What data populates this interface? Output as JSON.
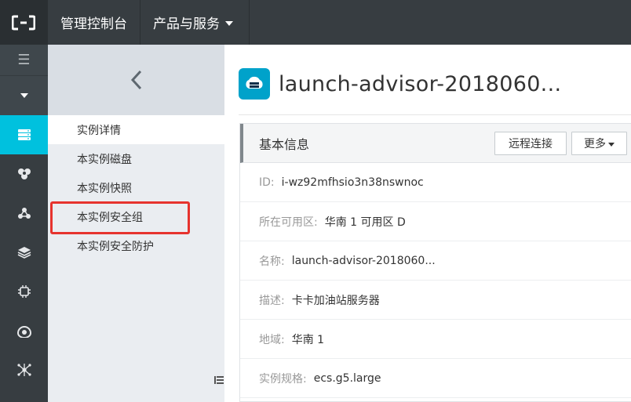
{
  "topbar": {
    "logo_icon": "aliyun-logo-icon",
    "console_label": "管理控制台",
    "products_label": "产品与服务"
  },
  "iconbar": {
    "accent_color": "#00c1de",
    "menu_glyph": "☰",
    "items": [
      "ecs-server-icon",
      "cluster-icon",
      "network-icon",
      "layers-icon",
      "chip-icon",
      "eye-icon",
      "molecule-icon"
    ]
  },
  "subside": {
    "back_icon": "chevron-left-icon",
    "items": [
      {
        "label": "实例详情",
        "active": true
      },
      {
        "label": "本实例磁盘"
      },
      {
        "label": "本实例快照"
      },
      {
        "label": "本实例安全组",
        "highlighted": true
      },
      {
        "label": "本实例安全防护"
      }
    ]
  },
  "main": {
    "title": "launch-advisor-2018060...",
    "panel": {
      "title": "基本信息",
      "remote_label": "远程连接",
      "more_label": "更多",
      "rows": [
        {
          "label": "ID:",
          "value": "i-wz92mfhsio3n38nswnoc"
        },
        {
          "label": "所在可用区:",
          "value": "华南 1 可用区 D"
        },
        {
          "label": "名称:",
          "value": "launch-advisor-2018060..."
        },
        {
          "label": "描述:",
          "value": "卡卡加油站服务器"
        },
        {
          "label": "地域:",
          "value": "华南 1"
        },
        {
          "label": "实例规格:",
          "value": "ecs.g5.large"
        }
      ]
    }
  }
}
